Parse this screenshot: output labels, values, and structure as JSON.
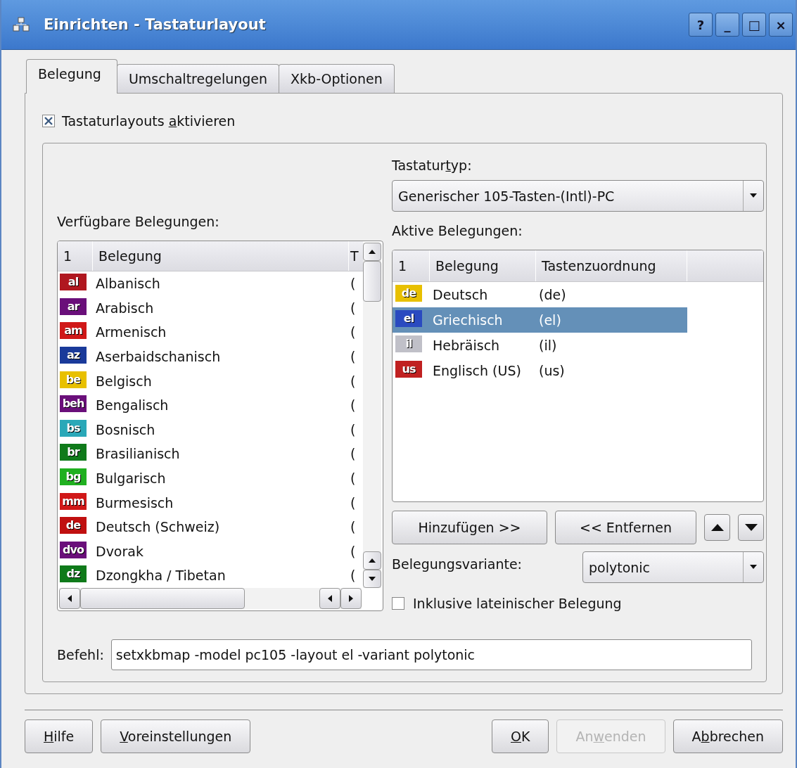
{
  "window": {
    "title": "Einrichten - Tastaturlayout",
    "controls": [
      "?",
      "_",
      "□",
      "×"
    ]
  },
  "tabs": [
    {
      "label": "Belegung",
      "selected": true
    },
    {
      "label": "Umschaltregelungen",
      "selected": false
    },
    {
      "label": "Xkb-Optionen",
      "selected": false
    }
  ],
  "enable": {
    "before": "Tastaturlayouts ",
    "mnemonic": "a",
    "after": "ktivieren",
    "checked": true
  },
  "keyboard_type": {
    "label": {
      "before": "Tastatur",
      "mnemonic": "t",
      "after": "yp:"
    },
    "value": "Generischer 105-Tasten-(Intl)-PC"
  },
  "available": {
    "label": "Verfügbare Belegungen:",
    "columns": [
      "1",
      "Belegung",
      "T"
    ],
    "rows": [
      {
        "code": "al",
        "color": "#b0171f",
        "name": "Albanisch",
        "column_3": "("
      },
      {
        "code": "ar",
        "color": "#6a0f7a",
        "name": "Arabisch",
        "column_3": "("
      },
      {
        "code": "am",
        "color": "#d01818",
        "name": "Armenisch",
        "column_3": "("
      },
      {
        "code": "az",
        "color": "#1a3a9a",
        "name": "Aserbaidschanisch",
        "column_3": "("
      },
      {
        "code": "be",
        "color": "#e8c000",
        "name": "Belgisch",
        "column_3": "("
      },
      {
        "code": "beh",
        "color": "#6a0f7a",
        "name": "Bengalisch",
        "column_3": "("
      },
      {
        "code": "bs",
        "color": "#2aa8b8",
        "name": "Bosnisch",
        "column_3": "("
      },
      {
        "code": "br",
        "color": "#0f7a1a",
        "name": "Brasilianisch",
        "column_3": "("
      },
      {
        "code": "bg",
        "color": "#20b020",
        "name": "Bulgarisch",
        "column_3": "("
      },
      {
        "code": "mm",
        "color": "#d01818",
        "name": "Burmesisch",
        "column_3": "("
      },
      {
        "code": "de",
        "color": "#c01010",
        "name": "Deutsch (Schweiz)",
        "column_3": "("
      },
      {
        "code": "dvo",
        "color": "#6a0f7a",
        "name": "Dvorak",
        "column_3": "("
      },
      {
        "code": "dz",
        "color": "#0f7a1a",
        "name": "Dzongkha / Tibetan",
        "column_3": "("
      }
    ]
  },
  "active": {
    "label": "Aktive Belegungen:",
    "columns": [
      "1",
      "Belegung",
      "Tastenzuordnung"
    ],
    "rows": [
      {
        "code": "de",
        "color": "#e8c000",
        "name": "Deutsch",
        "map": "(de)",
        "selected": false
      },
      {
        "code": "el",
        "color": "#2a4ac0",
        "name": "Griechisch",
        "map": "(el)",
        "selected": true
      },
      {
        "code": "il",
        "color": "#c0c0c8",
        "name": "Hebräisch",
        "map": "(il)",
        "selected": false
      },
      {
        "code": "us",
        "color": "#c02020",
        "name": "Englisch (US)",
        "map": "(us)",
        "selected": false
      }
    ]
  },
  "add_button": "Hinzufügen >>",
  "remove_button": "<< Entfernen",
  "variant": {
    "label": "Belegungsvariante:",
    "value": "polytonic"
  },
  "latin": {
    "label": "Inklusive lateinischer Belegung",
    "checked": false
  },
  "command": {
    "label": "Befehl:",
    "value": "setxkbmap -model pc105 -layout el -variant polytonic"
  },
  "buttons_left": [
    {
      "mnemonic": "H",
      "after": "ilfe",
      "disabled": false
    },
    {
      "mnemonic": "V",
      "after": "oreinstellungen",
      "disabled": false
    }
  ],
  "buttons_right": [
    {
      "mnemonic": "O",
      "after": "K",
      "disabled": false
    },
    {
      "before": "An",
      "mnemonic": "w",
      "after": "enden",
      "disabled": true
    },
    {
      "before": "A",
      "mnemonic": "b",
      "after": "brechen",
      "disabled": false
    }
  ]
}
